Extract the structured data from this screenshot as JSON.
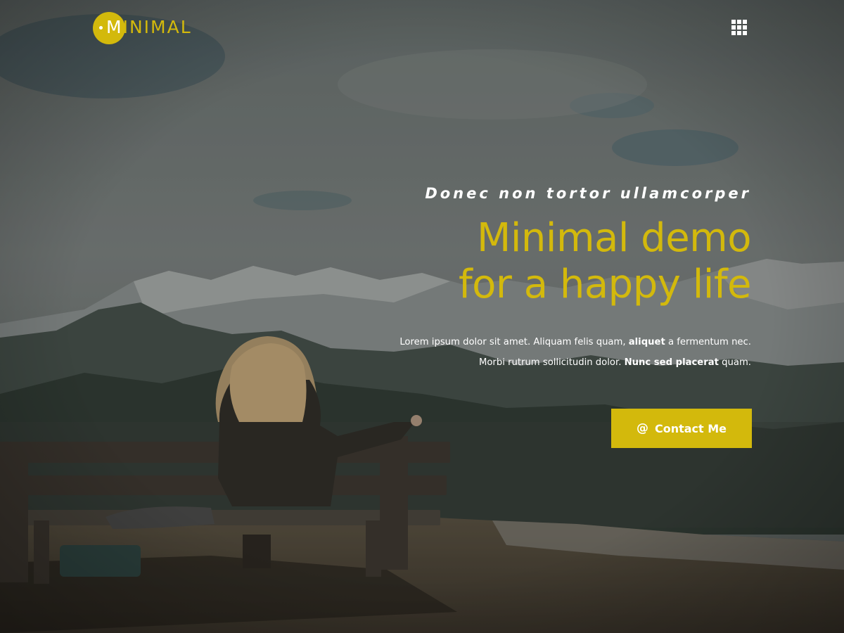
{
  "logo": {
    "first_letter": "M",
    "rest": "INIMAL"
  },
  "header": {
    "menu_icon": "grid-menu-icon"
  },
  "hero": {
    "kicker": "Donec non tortor ullamcorper",
    "title_line1": "Minimal demo",
    "title_line2": "for a happy life",
    "desc_line1_a": "Lorem ipsum dolor sit amet. Aliquam felis quam, ",
    "desc_line1_b": "aliquet",
    "desc_line1_c": " a fermentum nec.",
    "desc_line2_a": "Morbi rutrum sollicitudin dolor. ",
    "desc_line2_b": "Nunc sed placerat",
    "desc_line2_c": " quam.",
    "cta_icon": "@",
    "cta_label": "Contact Me"
  },
  "colors": {
    "accent": "#d3b90c",
    "text": "#ffffff"
  }
}
